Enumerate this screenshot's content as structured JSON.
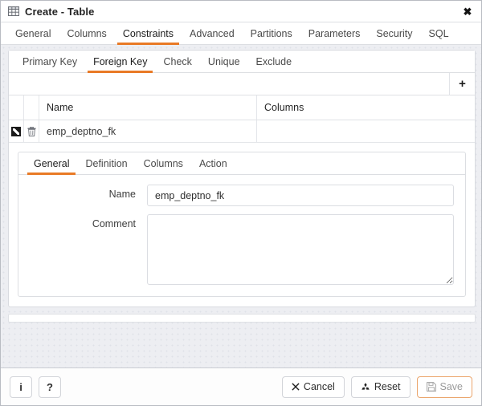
{
  "window": {
    "title": "Create - Table",
    "title_icon": "table-grid-icon",
    "close_icon": "close-icon",
    "accent_color": "#e97a26"
  },
  "main_tabs": [
    {
      "label": "General",
      "active": false
    },
    {
      "label": "Columns",
      "active": false
    },
    {
      "label": "Constraints",
      "active": true
    },
    {
      "label": "Advanced",
      "active": false
    },
    {
      "label": "Partitions",
      "active": false
    },
    {
      "label": "Parameters",
      "active": false
    },
    {
      "label": "Security",
      "active": false
    },
    {
      "label": "SQL",
      "active": false
    }
  ],
  "sub_tabs": [
    {
      "label": "Primary Key",
      "active": false
    },
    {
      "label": "Foreign Key",
      "active": true
    },
    {
      "label": "Check",
      "active": false
    },
    {
      "label": "Unique",
      "active": false
    },
    {
      "label": "Exclude",
      "active": false
    }
  ],
  "grid": {
    "add_button_label": "+",
    "columns": [
      "Name",
      "Columns"
    ],
    "rows": [
      {
        "edit_icon": "edit-pencil-icon",
        "delete_icon": "trash-icon",
        "name": "emp_deptno_fk",
        "columns": ""
      }
    ]
  },
  "editor": {
    "tabs": [
      {
        "label": "General",
        "active": true
      },
      {
        "label": "Definition",
        "active": false
      },
      {
        "label": "Columns",
        "active": false
      },
      {
        "label": "Action",
        "active": false
      }
    ],
    "fields": {
      "name_label": "Name",
      "name_value": "emp_deptno_fk",
      "name_placeholder": "",
      "comment_label": "Comment",
      "comment_value": "",
      "comment_placeholder": ""
    }
  },
  "footer": {
    "info_label": "i",
    "help_label": "?",
    "cancel_label": "Cancel",
    "cancel_icon": "close-x-icon",
    "reset_label": "Reset",
    "reset_icon": "recycle-refresh-icon",
    "save_label": "Save",
    "save_icon": "floppy-save-icon",
    "save_disabled": true
  }
}
